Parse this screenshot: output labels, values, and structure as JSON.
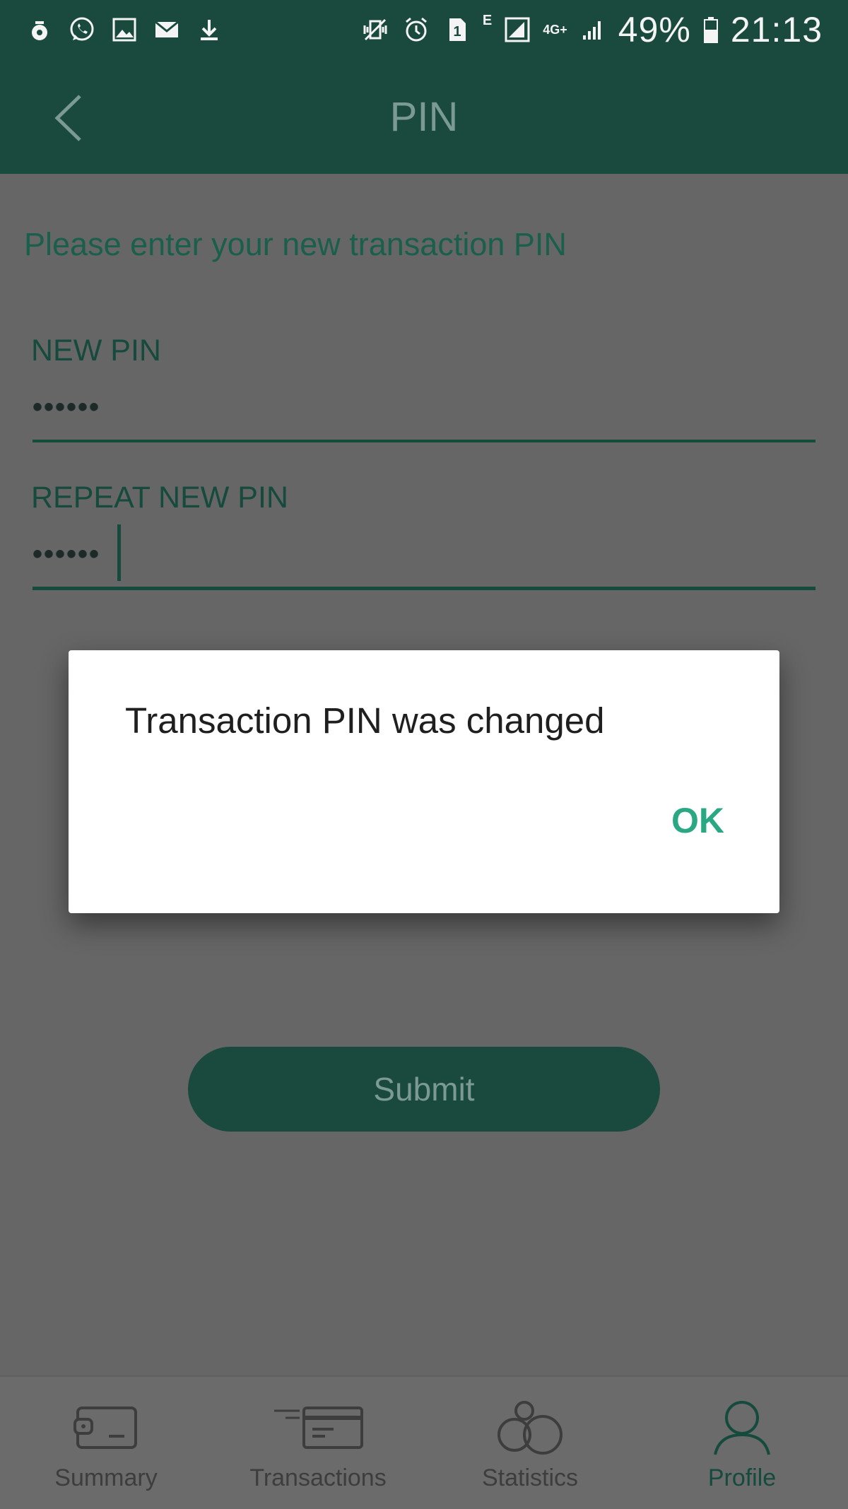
{
  "status_bar": {
    "network_badge": "E",
    "network_type": "4G+",
    "sim_slot": "1",
    "battery": "49%",
    "time": "21:13",
    "left_icons": [
      "app-notification-icon",
      "whatsapp-icon",
      "image-icon",
      "mail-icon",
      "download-icon"
    ],
    "right_icons": [
      "vibrate-off-icon",
      "alarm-icon",
      "sim-icon",
      "signal-icon",
      "data-arrows-icon",
      "signal-icon",
      "battery-icon"
    ]
  },
  "app_bar": {
    "title": "PIN",
    "back_icon": "chevron-left-icon"
  },
  "form": {
    "instruction": "Please enter your new transaction PIN",
    "new_pin_label": "NEW PIN",
    "new_pin_value": "••••••",
    "repeat_pin_label": "REPEAT NEW PIN",
    "repeat_pin_value": "••••••",
    "submit_label": "Submit"
  },
  "dialog": {
    "message": "Transaction PIN was changed",
    "ok_label": "OK"
  },
  "bottom_nav": {
    "items": [
      {
        "label": "Summary",
        "icon": "wallet-icon",
        "active": false
      },
      {
        "label": "Transactions",
        "icon": "card-icon",
        "active": false
      },
      {
        "label": "Statistics",
        "icon": "bubbles-icon",
        "active": false
      },
      {
        "label": "Profile",
        "icon": "person-icon",
        "active": true
      }
    ]
  },
  "colors": {
    "brand": "#1a4a3e",
    "accent": "#2aa884",
    "overlay": "#666666"
  }
}
